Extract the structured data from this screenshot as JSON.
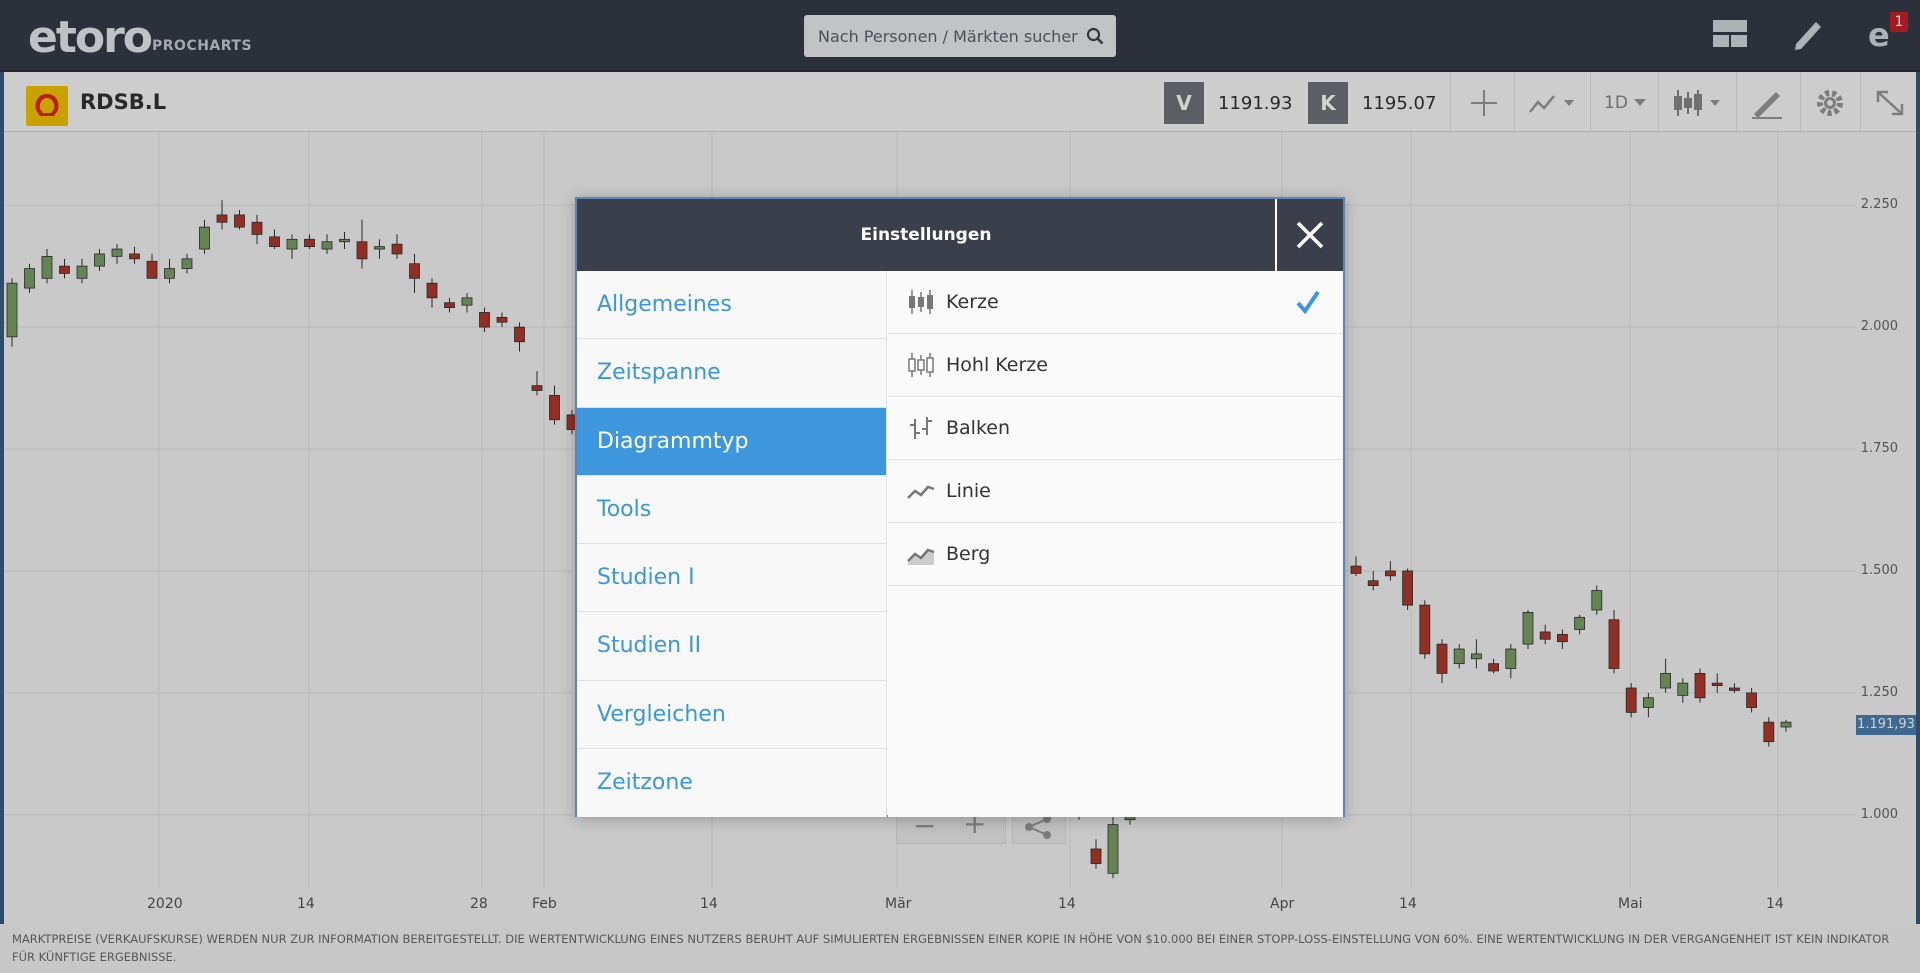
{
  "brand": {
    "logo": "etoro",
    "sub": "PROCHARTS"
  },
  "search": {
    "placeholder": "Nach Personen / Märkten suchen"
  },
  "notifications": {
    "count": "1"
  },
  "instrument": {
    "symbol": "RDSB.L"
  },
  "prices": {
    "sell_letter": "V",
    "sell_value": "1191.93",
    "buy_letter": "K",
    "buy_value": "1195.07",
    "current_tag": "1.191,93"
  },
  "toolbar": {
    "timeframe": "1D"
  },
  "chart_data": {
    "type": "candlestick",
    "y_ticks": [
      "2.250",
      "2.000",
      "1.750",
      "1.500",
      "1.250",
      "1.000"
    ],
    "y_values": [
      2250,
      2000,
      1750,
      1500,
      1250,
      1000
    ],
    "ylim": [
      850,
      2400
    ],
    "x_ticks": [
      "2020",
      "14",
      "28",
      "Feb",
      "14",
      "Mär",
      "14",
      "Apr",
      "14",
      "Mai",
      "14"
    ],
    "candles_left": [
      [
        1980,
        2100,
        1960,
        2090
      ],
      [
        2080,
        2130,
        2070,
        2120
      ],
      [
        2100,
        2160,
        2090,
        2145
      ],
      [
        2125,
        2140,
        2100,
        2110
      ],
      [
        2100,
        2140,
        2090,
        2125
      ],
      [
        2125,
        2160,
        2115,
        2150
      ],
      [
        2145,
        2170,
        2130,
        2160
      ],
      [
        2150,
        2165,
        2130,
        2140
      ],
      [
        2135,
        2150,
        2110,
        2100
      ],
      [
        2100,
        2140,
        2090,
        2120
      ],
      [
        2120,
        2150,
        2110,
        2140
      ],
      [
        2160,
        2220,
        2150,
        2205
      ],
      [
        2230,
        2260,
        2200,
        2215
      ],
      [
        2230,
        2240,
        2200,
        2205
      ],
      [
        2215,
        2230,
        2170,
        2190
      ],
      [
        2185,
        2200,
        2160,
        2165
      ],
      [
        2160,
        2190,
        2140,
        2180
      ],
      [
        2180,
        2190,
        2160,
        2165
      ],
      [
        2160,
        2190,
        2150,
        2175
      ],
      [
        2175,
        2195,
        2160,
        2180
      ],
      [
        2175,
        2220,
        2120,
        2140
      ],
      [
        2160,
        2180,
        2140,
        2165
      ],
      [
        2170,
        2190,
        2140,
        2150
      ],
      [
        2130,
        2150,
        2070,
        2100
      ],
      [
        2090,
        2100,
        2040,
        2060
      ],
      [
        2050,
        2060,
        2030,
        2040
      ],
      [
        2045,
        2070,
        2030,
        2060
      ],
      [
        2030,
        2040,
        1990,
        2000
      ],
      [
        2020,
        2030,
        2000,
        2010
      ],
      [
        2000,
        2010,
        1950,
        1970
      ],
      [
        1880,
        1910,
        1860,
        1870
      ],
      [
        1860,
        1880,
        1800,
        1810
      ],
      [
        1820,
        1830,
        1780,
        1790
      ],
      [
        1800,
        1815,
        1790,
        1805
      ]
    ],
    "candles_right": [
      [
        1510,
        1530,
        1490,
        1495
      ],
      [
        1480,
        1500,
        1460,
        1470
      ],
      [
        1500,
        1520,
        1480,
        1490
      ],
      [
        1500,
        1505,
        1420,
        1430
      ],
      [
        1430,
        1440,
        1320,
        1330
      ],
      [
        1350,
        1360,
        1270,
        1290
      ],
      [
        1310,
        1350,
        1300,
        1340
      ],
      [
        1320,
        1360,
        1300,
        1330
      ],
      [
        1310,
        1320,
        1290,
        1295
      ],
      [
        1300,
        1350,
        1280,
        1340
      ],
      [
        1350,
        1420,
        1340,
        1415
      ],
      [
        1375,
        1390,
        1350,
        1360
      ],
      [
        1370,
        1380,
        1340,
        1355
      ],
      [
        1380,
        1410,
        1370,
        1405
      ],
      [
        1420,
        1470,
        1410,
        1460
      ],
      [
        1400,
        1420,
        1290,
        1300
      ],
      [
        1260,
        1270,
        1200,
        1210
      ],
      [
        1220,
        1250,
        1200,
        1240
      ],
      [
        1260,
        1320,
        1250,
        1290
      ],
      [
        1245,
        1280,
        1230,
        1270
      ],
      [
        1290,
        1300,
        1230,
        1240
      ],
      [
        1270,
        1290,
        1250,
        1265
      ],
      [
        1260,
        1270,
        1250,
        1255
      ],
      [
        1250,
        1260,
        1210,
        1220
      ],
      [
        1190,
        1200,
        1140,
        1150
      ],
      [
        1180,
        1195,
        1170,
        1190
      ]
    ],
    "candles_bottom": [
      [
        1000,
        1020,
        990,
        1010
      ],
      [
        930,
        950,
        890,
        900
      ],
      [
        880,
        1000,
        870,
        980
      ],
      [
        990,
        1020,
        980,
        1010
      ]
    ]
  },
  "modal": {
    "title": "Einstellungen",
    "menu": [
      "Allgemeines",
      "Zeitspanne",
      "Diagrammtyp",
      "Tools",
      "Studien I",
      "Studien II",
      "Vergleichen",
      "Zeitzone"
    ],
    "active_menu": 2,
    "options": [
      {
        "label": "Kerze",
        "icon": "candle-icon",
        "selected": true
      },
      {
        "label": "Hohl Kerze",
        "icon": "hollow-candle-icon",
        "selected": false
      },
      {
        "label": "Balken",
        "icon": "bar-icon",
        "selected": false
      },
      {
        "label": "Linie",
        "icon": "line-icon",
        "selected": false
      },
      {
        "label": "Berg",
        "icon": "mountain-icon",
        "selected": false
      }
    ]
  },
  "disclaimer": "MARKTPREISE (VERKAUFSKURSE) WERDEN NUR ZUR INFORMATION BEREITGESTELLT. DIE WERTENTWICKLUNG EINES NUTZERS BERUHT AUF SIMULIERTEN ERGEBNISSEN EINER KOPIE IN HÖHE VON $10.000 BEI EINER STOPP-LOSS-EINSTELLUNG VON 60%. EINE WERTENTWICKLUNG IN DER VERGANGENHEIT IST KEIN INDIKATOR FÜR KÜNFTIGE ERGEBNISSE.",
  "colors": {
    "accent": "#3e97dd",
    "up": "#7aa267",
    "down": "#b23a2c",
    "header": "#3a3f4b"
  }
}
